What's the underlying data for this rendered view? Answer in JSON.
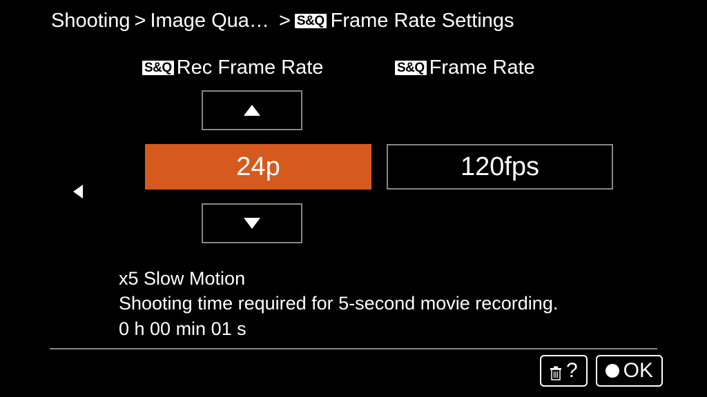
{
  "breadcrumb": {
    "item1": "Shooting",
    "item2": "Image Qua…",
    "item3": "Frame Rate Settings",
    "sq_badge": "S&Q"
  },
  "headers": {
    "col1": "Rec Frame Rate",
    "col2": "Frame Rate",
    "sq_badge": "S&Q"
  },
  "values": {
    "rec_frame_rate": "24p",
    "frame_rate": "120fps"
  },
  "info": {
    "line1": "x5 Slow Motion",
    "line2": "Shooting time required for 5-second movie recording.",
    "line3": "0 h 00 min 01 s"
  },
  "footer": {
    "help": "?",
    "ok": "OK"
  },
  "colors": {
    "accent": "#d65a1e"
  }
}
